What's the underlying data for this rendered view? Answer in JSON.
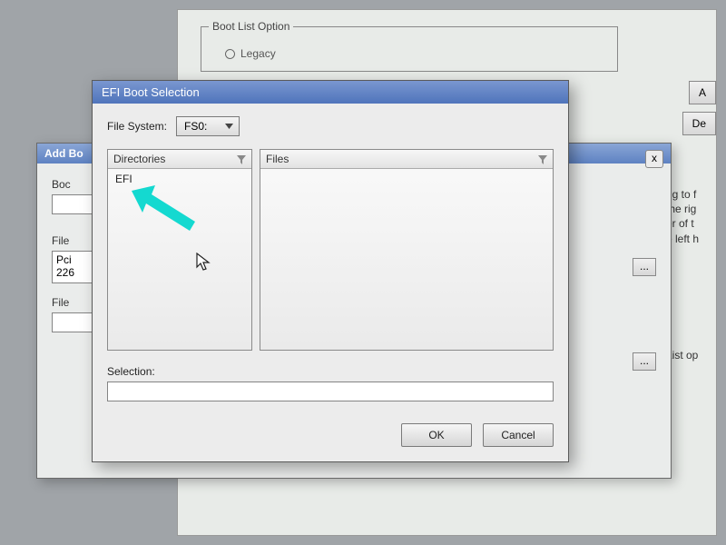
{
  "background": {
    "group_title": "Boot List Option",
    "radio1": "Legacy",
    "right_btn_a": "A",
    "right_btn_de": "De",
    "right_text": "ng to f\nthe rig\ner of t\ne left h",
    "right_text2": "List op\ng"
  },
  "addbo": {
    "title": "Add Bo",
    "boc_label": "Boc",
    "file_label1": "File",
    "file_label2": "File",
    "pci_value": "Pci\n226",
    "close_symbol": "x",
    "browse_symbol": "..."
  },
  "efi": {
    "title": "EFI Boot Selection",
    "fs_label": "File System:",
    "fs_value": "FS0:",
    "dir_header": "Directories",
    "files_header": "Files",
    "directories": [
      "EFI"
    ],
    "files": [],
    "selection_label": "Selection:",
    "selection_value": "",
    "ok": "OK",
    "cancel": "Cancel"
  }
}
